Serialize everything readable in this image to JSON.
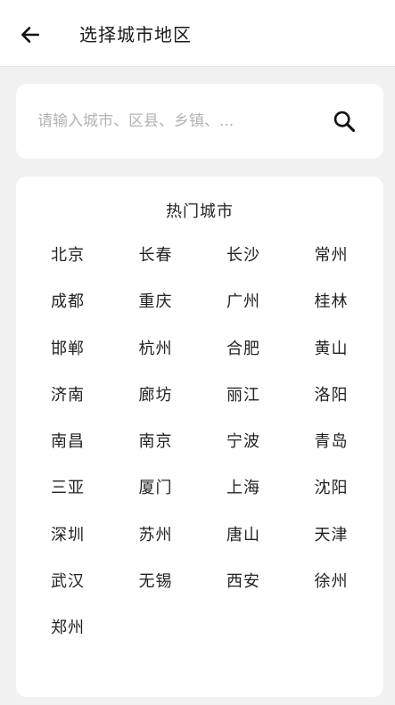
{
  "header": {
    "title": "选择城市地区"
  },
  "search": {
    "placeholder": "请输入城市、区县、乡镇、..."
  },
  "hot_cities": {
    "title": "热门城市",
    "items": [
      "北京",
      "长春",
      "长沙",
      "常州",
      "成都",
      "重庆",
      "广州",
      "桂林",
      "邯郸",
      "杭州",
      "合肥",
      "黄山",
      "济南",
      "廊坊",
      "丽江",
      "洛阳",
      "南昌",
      "南京",
      "宁波",
      "青岛",
      "三亚",
      "厦门",
      "上海",
      "沈阳",
      "深圳",
      "苏州",
      "唐山",
      "天津",
      "武汉",
      "无锡",
      "西安",
      "徐州",
      "郑州"
    ]
  },
  "icons": {
    "back": "arrow-left-icon",
    "search": "search-icon"
  }
}
